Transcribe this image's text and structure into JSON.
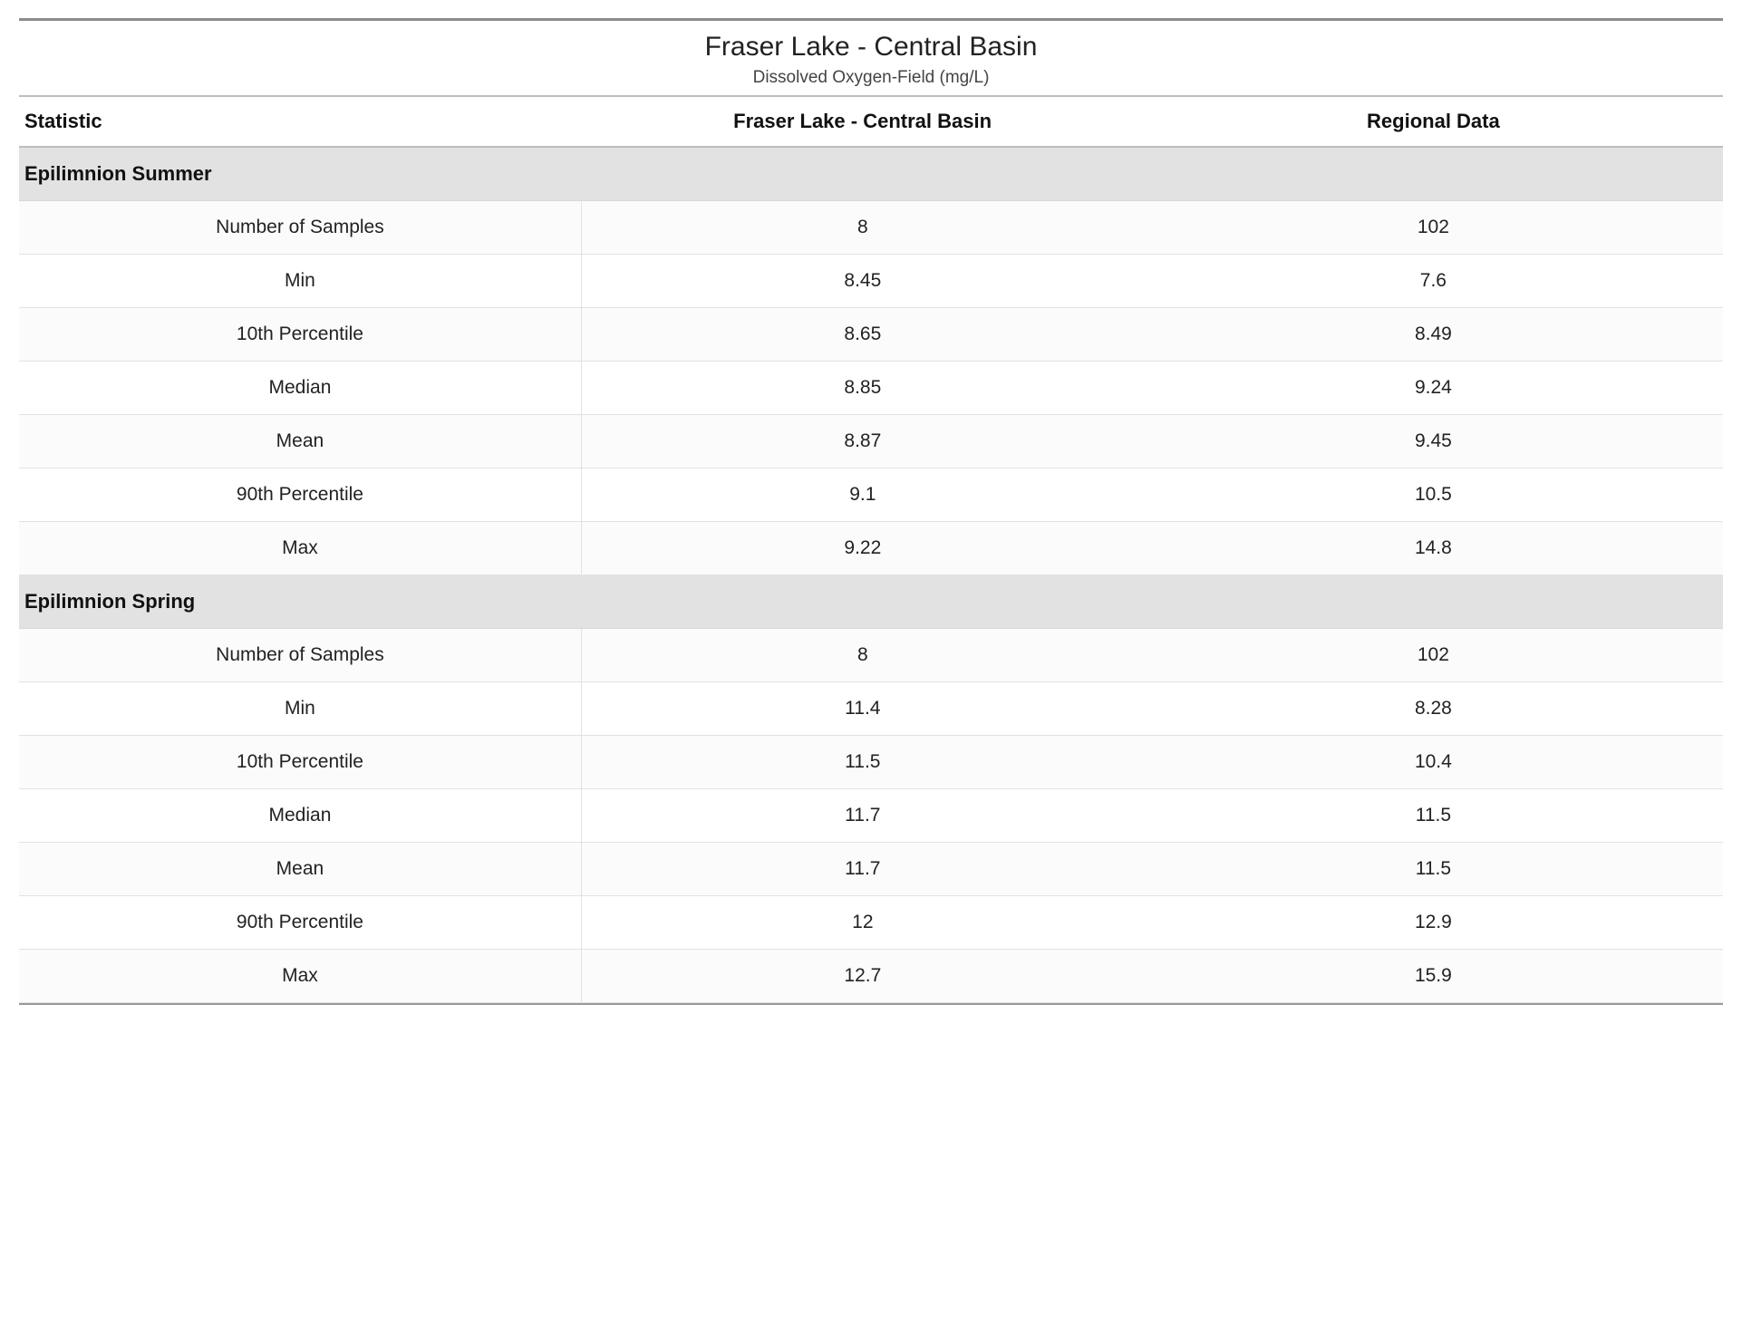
{
  "header": {
    "title": "Fraser Lake - Central Basin",
    "subtitle": "Dissolved Oxygen-Field (mg/L)"
  },
  "columns": {
    "stat": "Statistic",
    "site": "Fraser Lake - Central Basin",
    "regional": "Regional Data"
  },
  "sections": [
    {
      "name": "Epilimnion Summer",
      "rows": [
        {
          "stat": "Number of Samples",
          "site": "8",
          "regional": "102"
        },
        {
          "stat": "Min",
          "site": "8.45",
          "regional": "7.6"
        },
        {
          "stat": "10th Percentile",
          "site": "8.65",
          "regional": "8.49"
        },
        {
          "stat": "Median",
          "site": "8.85",
          "regional": "9.24"
        },
        {
          "stat": "Mean",
          "site": "8.87",
          "regional": "9.45"
        },
        {
          "stat": "90th Percentile",
          "site": "9.1",
          "regional": "10.5"
        },
        {
          "stat": "Max",
          "site": "9.22",
          "regional": "14.8"
        }
      ]
    },
    {
      "name": "Epilimnion Spring",
      "rows": [
        {
          "stat": "Number of Samples",
          "site": "8",
          "regional": "102"
        },
        {
          "stat": "Min",
          "site": "11.4",
          "regional": "8.28"
        },
        {
          "stat": "10th Percentile",
          "site": "11.5",
          "regional": "10.4"
        },
        {
          "stat": "Median",
          "site": "11.7",
          "regional": "11.5"
        },
        {
          "stat": "Mean",
          "site": "11.7",
          "regional": "11.5"
        },
        {
          "stat": "90th Percentile",
          "site": "12",
          "regional": "12.9"
        },
        {
          "stat": "Max",
          "site": "12.7",
          "regional": "15.9"
        }
      ]
    }
  ]
}
